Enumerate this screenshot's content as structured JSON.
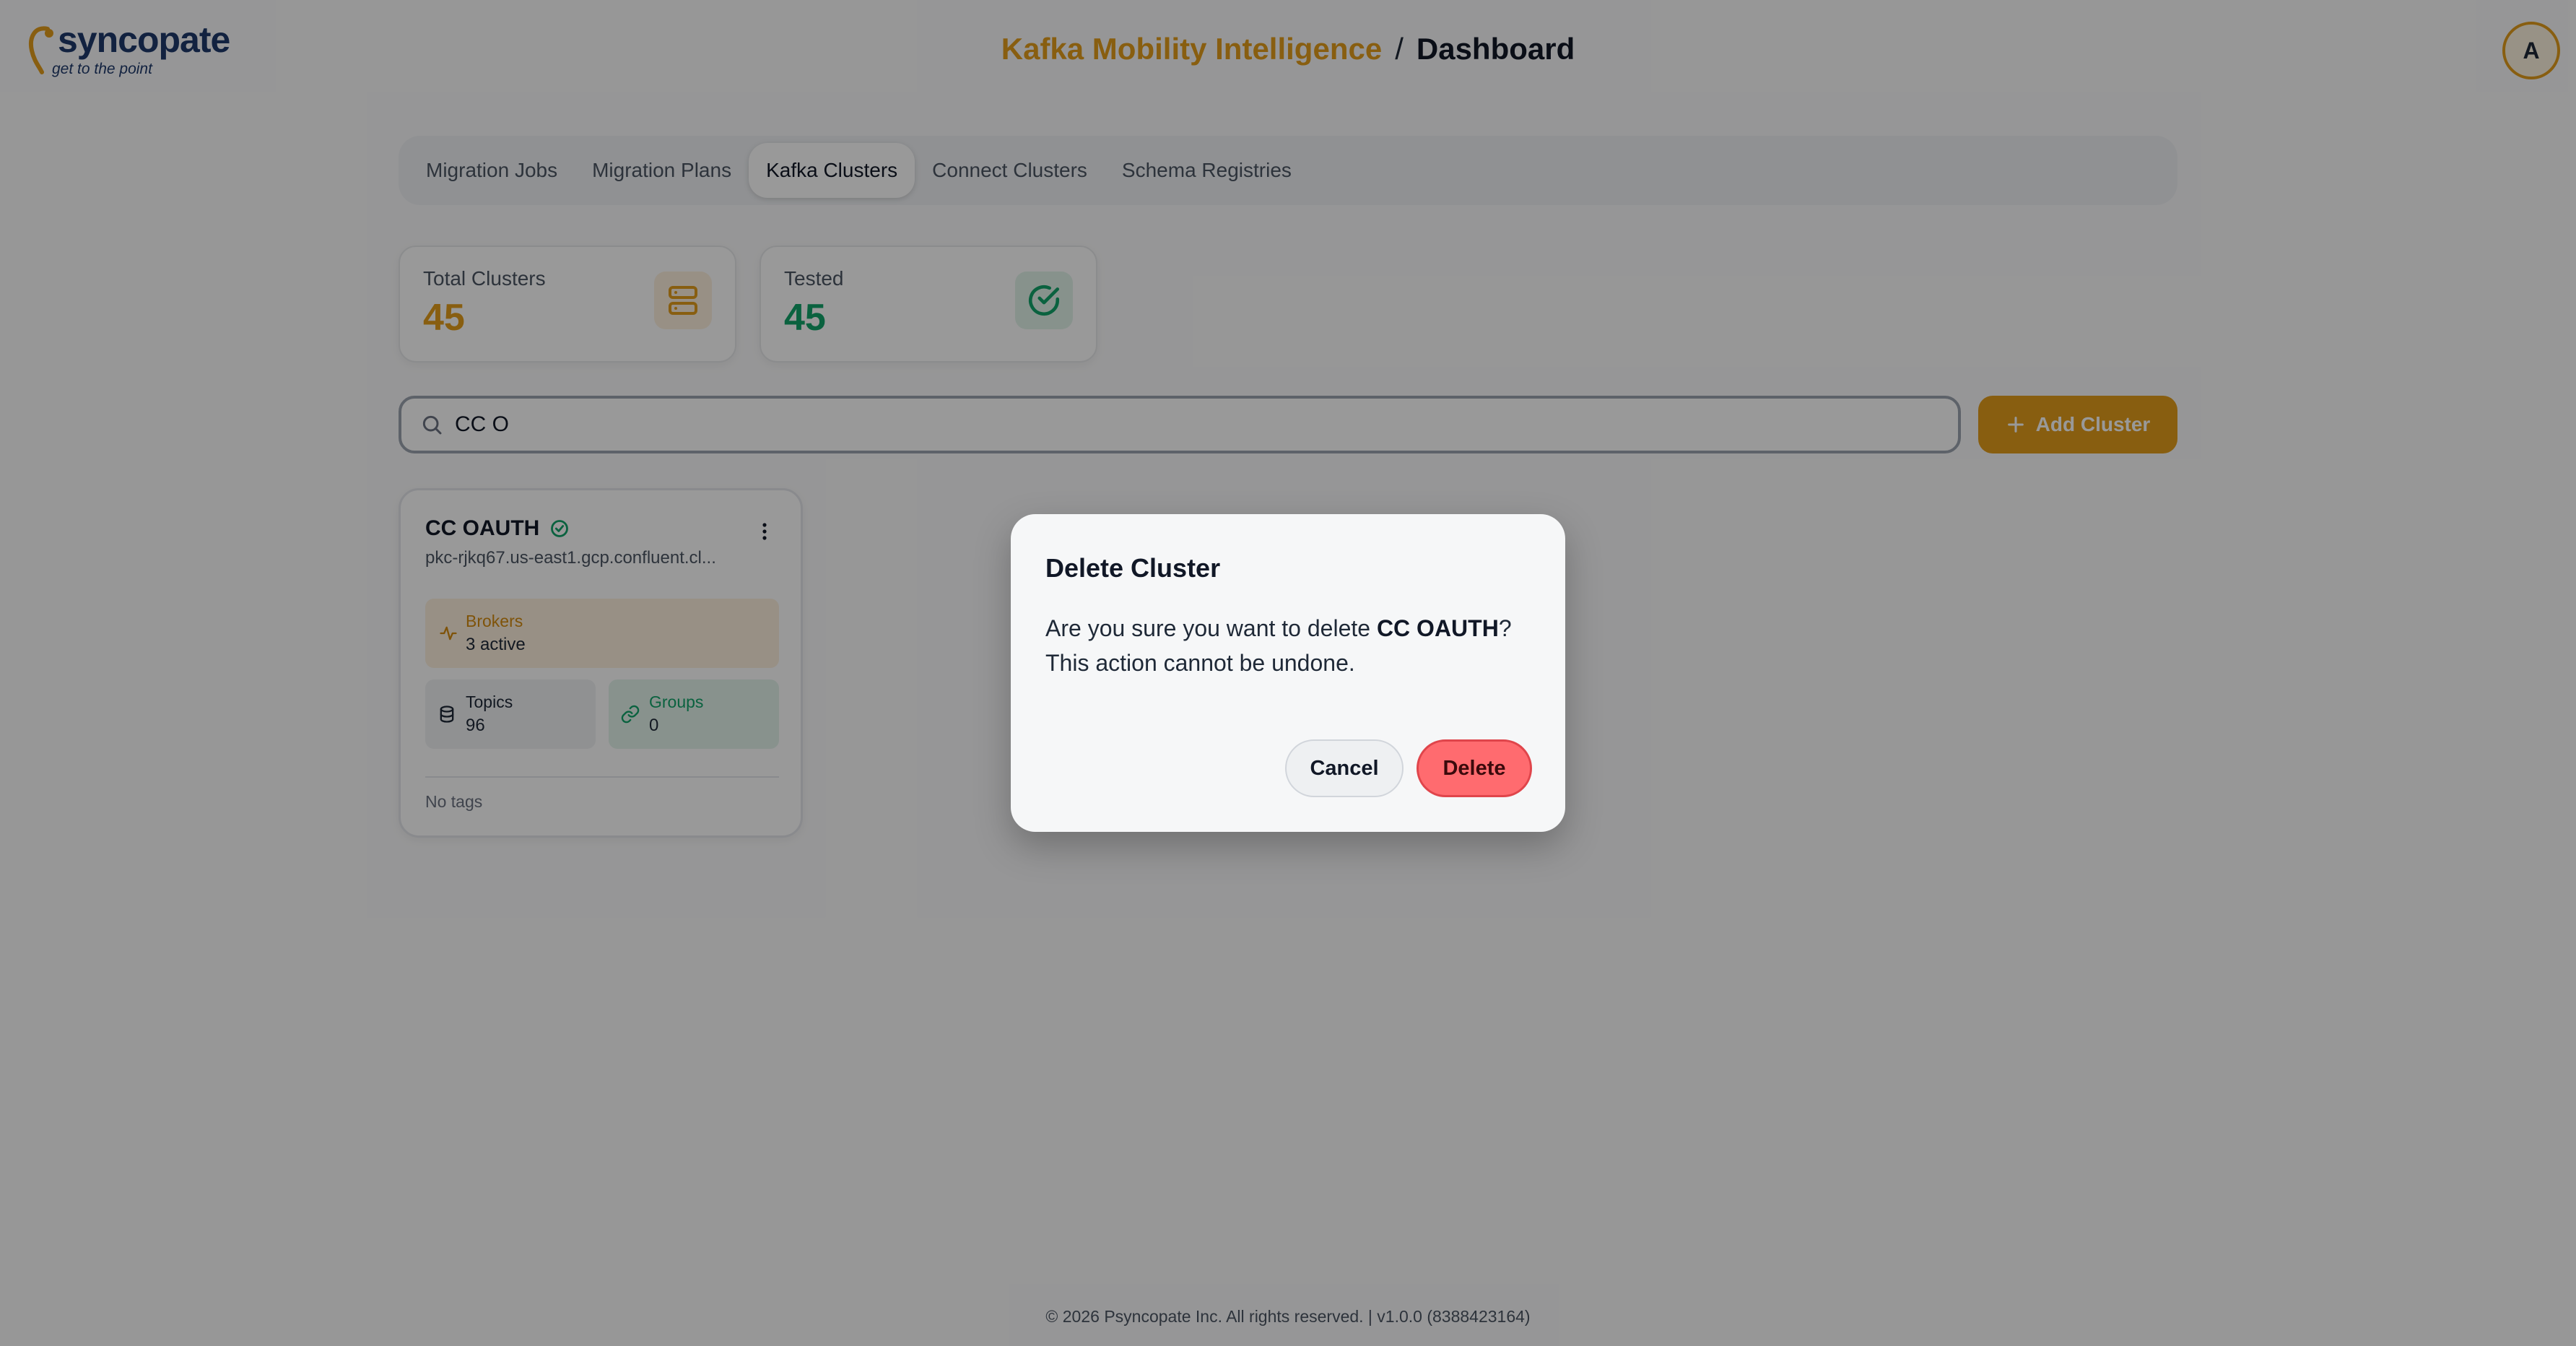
{
  "header": {
    "logo_text": "syncopate",
    "logo_tagline": "get to the point",
    "app_name": "Kafka Mobility Intelligence",
    "separator": "/",
    "page": "Dashboard",
    "avatar_initial": "A"
  },
  "tabs": [
    {
      "label": "Migration Jobs",
      "active": false
    },
    {
      "label": "Migration Plans",
      "active": false
    },
    {
      "label": "Kafka Clusters",
      "active": true
    },
    {
      "label": "Connect Clusters",
      "active": false
    },
    {
      "label": "Schema Registries",
      "active": false
    }
  ],
  "stats": {
    "total": {
      "label": "Total Clusters",
      "value": "45",
      "icon": "server-icon",
      "color": "#e39d1c"
    },
    "tested": {
      "label": "Tested",
      "value": "45",
      "icon": "check-circle-icon",
      "color": "#12a36a"
    }
  },
  "search": {
    "value": "CC O",
    "icon": "search-icon"
  },
  "add_button": {
    "label": "Add Cluster",
    "icon": "plus-icon"
  },
  "cluster": {
    "name": "CC OAUTH",
    "host": "pkc-rjkq67.us-east1.gcp.confluent.cl...",
    "brokers_label": "Brokers",
    "brokers_value": "3 active",
    "topics_label": "Topics",
    "topics_value": "96",
    "groups_label": "Groups",
    "groups_value": "0",
    "tags": "No tags"
  },
  "footer": "© 2026 Psyncopate Inc. All rights reserved. | v1.0.0 (8388423164)",
  "modal": {
    "title": "Delete Cluster",
    "body_prefix": "Are you sure you want to delete ",
    "body_name": "CC OAUTH",
    "body_suffix": "?",
    "body_line2": "This action cannot be undone.",
    "cancel_label": "Cancel",
    "delete_label": "Delete"
  },
  "colors": {
    "accent": "#e39d1c",
    "success": "#12a36a",
    "danger": "#ff6b6f"
  }
}
